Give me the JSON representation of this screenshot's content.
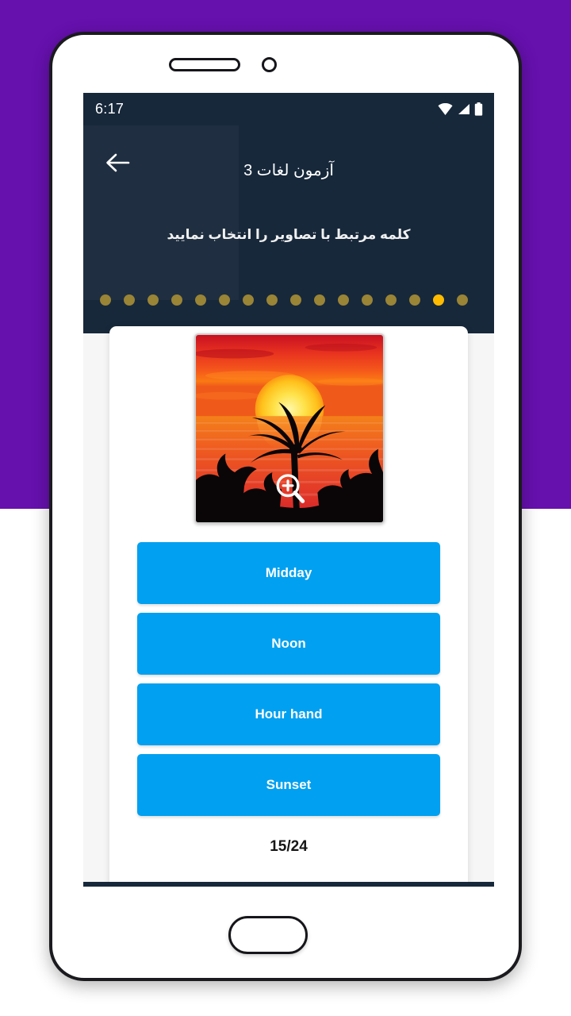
{
  "device": {
    "frame_color": "#1b1b1f",
    "speaker_icon": "speaker-slot",
    "camera_icon": "front-camera",
    "home_button_icon": "home-button"
  },
  "backdrop": {
    "purple": "#6610ae",
    "white": "#ffffff"
  },
  "status_bar": {
    "time": "6:17",
    "background": "#17283b",
    "icons": [
      "wifi-icon",
      "signal-icon",
      "battery-icon"
    ]
  },
  "app_header": {
    "background": "#17283b",
    "back_icon": "back-arrow-icon",
    "title": "آزمون لغات 3",
    "subtitle": "کلمه مرتبط با تصاویر را انتخاب نمایید",
    "progress": {
      "total_visible": 16,
      "active_index": 14,
      "done_color": "#9a8435",
      "active_color": "#ffbb00"
    }
  },
  "question_card": {
    "image": {
      "icon": "sunset-palm-tree-photo",
      "zoom_icon": "magnifier-plus-icon",
      "alt": "Sunset over ocean with palm tree silhouettes"
    },
    "answers": [
      {
        "label": "Midday"
      },
      {
        "label": "Noon"
      },
      {
        "label": "Hour hand"
      },
      {
        "label": "Sunset"
      }
    ],
    "answer_color": "#01a0f0",
    "counter": "15/24"
  }
}
